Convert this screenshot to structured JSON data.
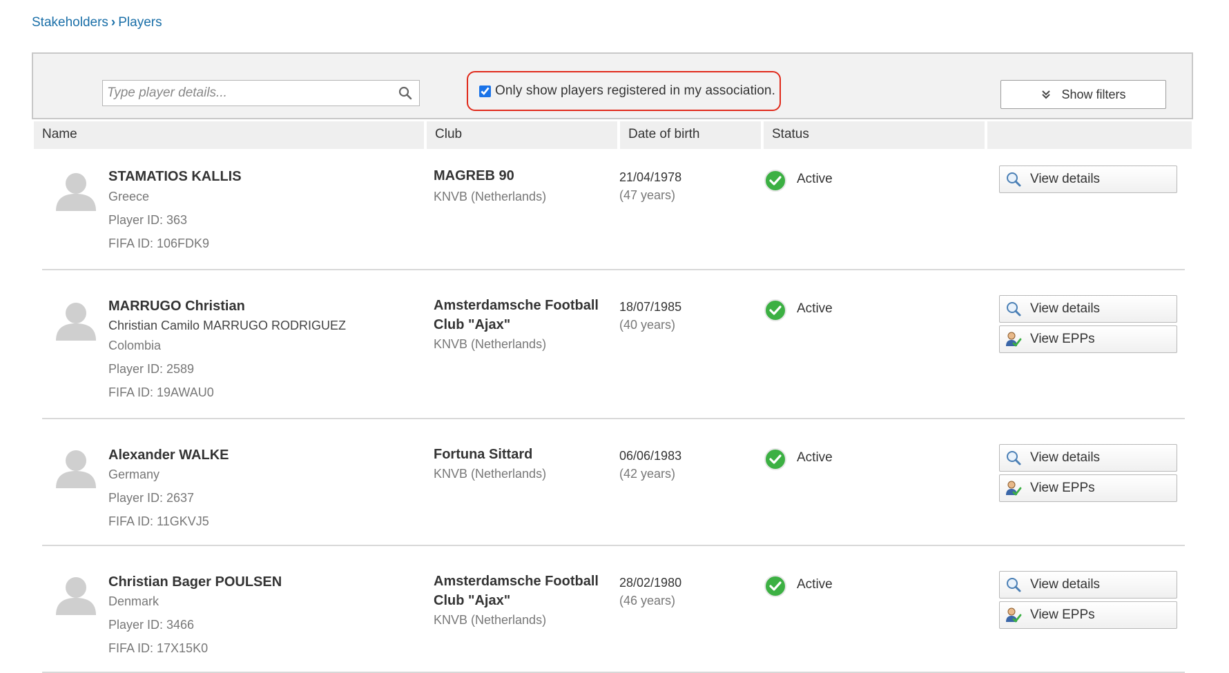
{
  "breadcrumb": {
    "parent": "Stakeholders",
    "current": "Players"
  },
  "toolbar": {
    "search_placeholder": "Type player details...",
    "assoc_only_label": "Only show players registered in my association.",
    "assoc_only_checked": true,
    "show_filters_label": "Show filters"
  },
  "columns": {
    "name": "Name",
    "club": "Club",
    "dob": "Date of birth",
    "status": "Status",
    "actions": ""
  },
  "players": [
    {
      "name": "STAMATIOS KALLIS",
      "full_name": "",
      "country": "Greece",
      "player_id": "Player ID: 363",
      "fifa_id": "FIFA ID: 106FDK9",
      "club_line1": "MAGREB 90",
      "club_line2": "",
      "association": "KNVB (Netherlands)",
      "dob": "21/04/1978",
      "age": "(47 years)",
      "status": "Active",
      "view_details": "View details",
      "view_epps": ""
    },
    {
      "name": "MARRUGO Christian",
      "full_name": "Christian Camilo MARRUGO RODRIGUEZ",
      "country": "Colombia",
      "player_id": "Player ID: 2589",
      "fifa_id": "FIFA ID: 19AWAU0",
      "club_line1": "Amsterdamsche Football",
      "club_line2": "Club \"Ajax\"",
      "association": "KNVB (Netherlands)",
      "dob": "18/07/1985",
      "age": "(40 years)",
      "status": "Active",
      "view_details": "View details",
      "view_epps": "View EPPs"
    },
    {
      "name": "Alexander WALKE",
      "full_name": "",
      "country": "Germany",
      "player_id": "Player ID: 2637",
      "fifa_id": "FIFA ID: 11GKVJ5",
      "club_line1": "Fortuna Sittard",
      "club_line2": "",
      "association": "KNVB (Netherlands)",
      "dob": "06/06/1983",
      "age": "(42 years)",
      "status": "Active",
      "view_details": "View details",
      "view_epps": "View EPPs"
    },
    {
      "name": "Christian Bager POULSEN",
      "full_name": "",
      "country": "Denmark",
      "player_id": "Player ID: 3466",
      "fifa_id": "FIFA ID: 17X15K0",
      "club_line1": "Amsterdamsche Football",
      "club_line2": "Club \"Ajax\"",
      "association": "KNVB (Netherlands)",
      "dob": "28/02/1980",
      "age": "(46 years)",
      "status": "Active",
      "view_details": "View details",
      "view_epps": "View EPPs"
    }
  ],
  "colors": {
    "link": "#1a6fa8",
    "highlight": "#e0291a",
    "active": "#3cb043"
  }
}
